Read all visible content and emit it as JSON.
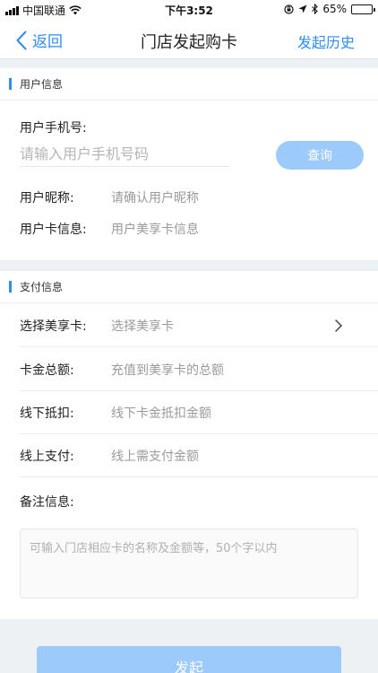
{
  "status_bar": {
    "carrier": "中国联通",
    "time": "下午3:52",
    "battery": "65%",
    "battery_level": 0.65
  },
  "nav": {
    "back_label": "返回",
    "title": "门店发起购卡",
    "history_label": "发起历史"
  },
  "user_section": {
    "title": "用户信息",
    "phone_label": "用户手机号:",
    "phone_placeholder": "请输入用户手机号码",
    "query_label": "查询",
    "nickname_label": "用户昵称:",
    "nickname_value": "请确认用户昵称",
    "card_info_label": "用户卡信息:",
    "card_info_value": "用户美享卡信息"
  },
  "payment_section": {
    "title": "支付信息",
    "rows": [
      {
        "label": "选择美享卡:",
        "placeholder": "选择美享卡"
      },
      {
        "label": "卡金总额:",
        "placeholder": "充值到美享卡的总额"
      },
      {
        "label": "线下抵扣:",
        "placeholder": "线下卡金抵扣金额"
      },
      {
        "label": "线上支付:",
        "placeholder": "线上需支付金额"
      }
    ],
    "remark_label": "备注信息:",
    "remark_placeholder": "可输入门店相应卡的名称及金额等，50个字以内"
  },
  "submit_label": "发起",
  "colors": {
    "accent": "#2f8cf3",
    "button_disabled": "#9ccafb"
  }
}
